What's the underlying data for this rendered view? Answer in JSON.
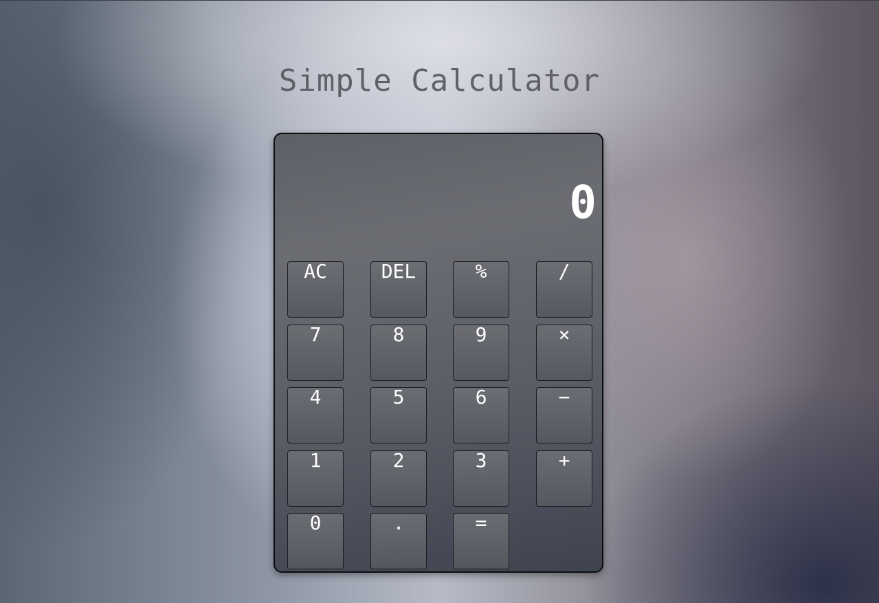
{
  "page": {
    "title": "Simple Calculator"
  },
  "calculator": {
    "display": "0",
    "keys": {
      "ac": "AC",
      "del": "DEL",
      "percent": "%",
      "divide": "/",
      "seven": "7",
      "eight": "8",
      "nine": "9",
      "multiply": "×",
      "four": "4",
      "five": "5",
      "six": "6",
      "subtract": "−",
      "one": "1",
      "two": "2",
      "three": "3",
      "add": "+",
      "zero": "0",
      "decimal": ".",
      "equals": "="
    }
  },
  "colors": {
    "title_text": "#5f6068",
    "body_bg": "#5a5d65",
    "key_text": "#ffffff",
    "border": "#0c0c0e"
  }
}
